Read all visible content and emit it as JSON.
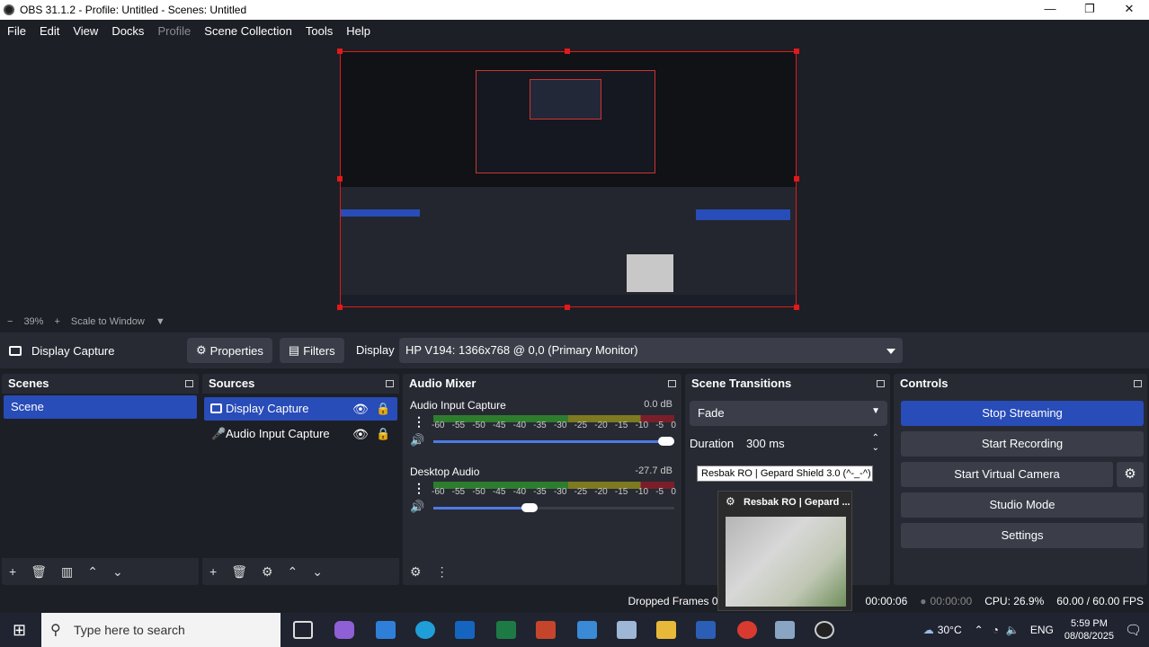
{
  "window": {
    "title": "OBS 31.1.2 - Profile: Untitled - Scenes: Untitled",
    "minimize": "—",
    "restore": "❐",
    "close": "✕"
  },
  "menu": [
    {
      "label": "File",
      "enabled": true
    },
    {
      "label": "Edit",
      "enabled": true
    },
    {
      "label": "View",
      "enabled": true
    },
    {
      "label": "Docks",
      "enabled": true
    },
    {
      "label": "Profile",
      "enabled": false
    },
    {
      "label": "Scene Collection",
      "enabled": true
    },
    {
      "label": "Tools",
      "enabled": true
    },
    {
      "label": "Help",
      "enabled": true
    }
  ],
  "zoom": {
    "minus": "−",
    "value": "39%",
    "plus": "+",
    "mode": "Scale to Window"
  },
  "source_toolbar": {
    "source_name": "Display Capture",
    "properties": "Properties",
    "filters": "Filters",
    "display_label": "Display",
    "display_value": "HP V194: 1366x768 @ 0,0 (Primary Monitor)"
  },
  "scenes": {
    "title": "Scenes",
    "items": [
      "Scene"
    ]
  },
  "sources": {
    "title": "Sources",
    "items": [
      {
        "name": "Display Capture",
        "selected": true,
        "icon": "monitor-icon"
      },
      {
        "name": "Audio Input Capture",
        "selected": false,
        "icon": "microphone-icon"
      }
    ]
  },
  "mixer": {
    "title": "Audio Mixer",
    "channels": [
      {
        "name": "Audio Input Capture",
        "db": "0.0 dB",
        "volume": 1.0
      },
      {
        "name": "Desktop Audio",
        "db": "-27.7 dB",
        "volume": 0.4
      }
    ],
    "ticks": [
      "-60",
      "-55",
      "-50",
      "-45",
      "-40",
      "-35",
      "-30",
      "-25",
      "-20",
      "-15",
      "-10",
      "-5",
      "0"
    ]
  },
  "transitions": {
    "title": "Scene Transitions",
    "selected": "Fade",
    "duration_label": "Duration",
    "duration_value": "300 ms"
  },
  "controls": {
    "title": "Controls",
    "stop_streaming": "Stop Streaming",
    "start_recording": "Start Recording",
    "start_virtual_camera": "Start Virtual Camera",
    "studio_mode": "Studio Mode",
    "settings": "Settings"
  },
  "status": {
    "dropped_frames": "Dropped Frames 0",
    "stream_time": "00:00:06",
    "rec_time": "00:00:00",
    "cpu": "CPU: 26.9%",
    "fps": "60.00 / 60.00 FPS"
  },
  "tooltip": "Resbak RO | Gepard Shield 3.0 (^-_-^)",
  "thumbnail_title": "Resbak RO | Gepard ...",
  "taskbar": {
    "search_placeholder": "Type here to search",
    "weather": "30°C",
    "lang": "ENG",
    "time": "5:59 PM",
    "date": "08/08/2025"
  }
}
